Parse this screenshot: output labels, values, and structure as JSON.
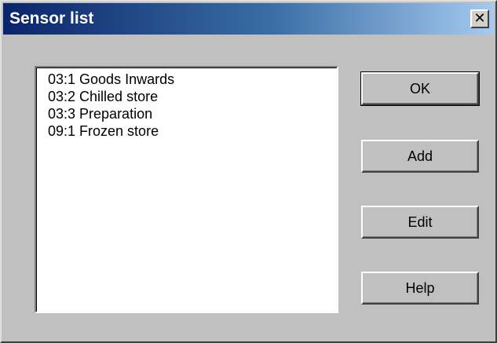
{
  "window": {
    "title": "Sensor list",
    "close_icon": "close-icon",
    "close_glyph": "✕"
  },
  "sensor_list": {
    "items": [
      "03:1 Goods Inwards",
      "03:2 Chilled store",
      "03:3 Preparation",
      "09:1 Frozen store"
    ]
  },
  "buttons": {
    "ok_label": "OK",
    "add_label": "Add",
    "edit_label": "Edit",
    "help_label": "Help"
  },
  "colors": {
    "titlebar_start": "#0a246a",
    "titlebar_end": "#a6caf0",
    "dialog_bg": "#c0c0c0"
  }
}
